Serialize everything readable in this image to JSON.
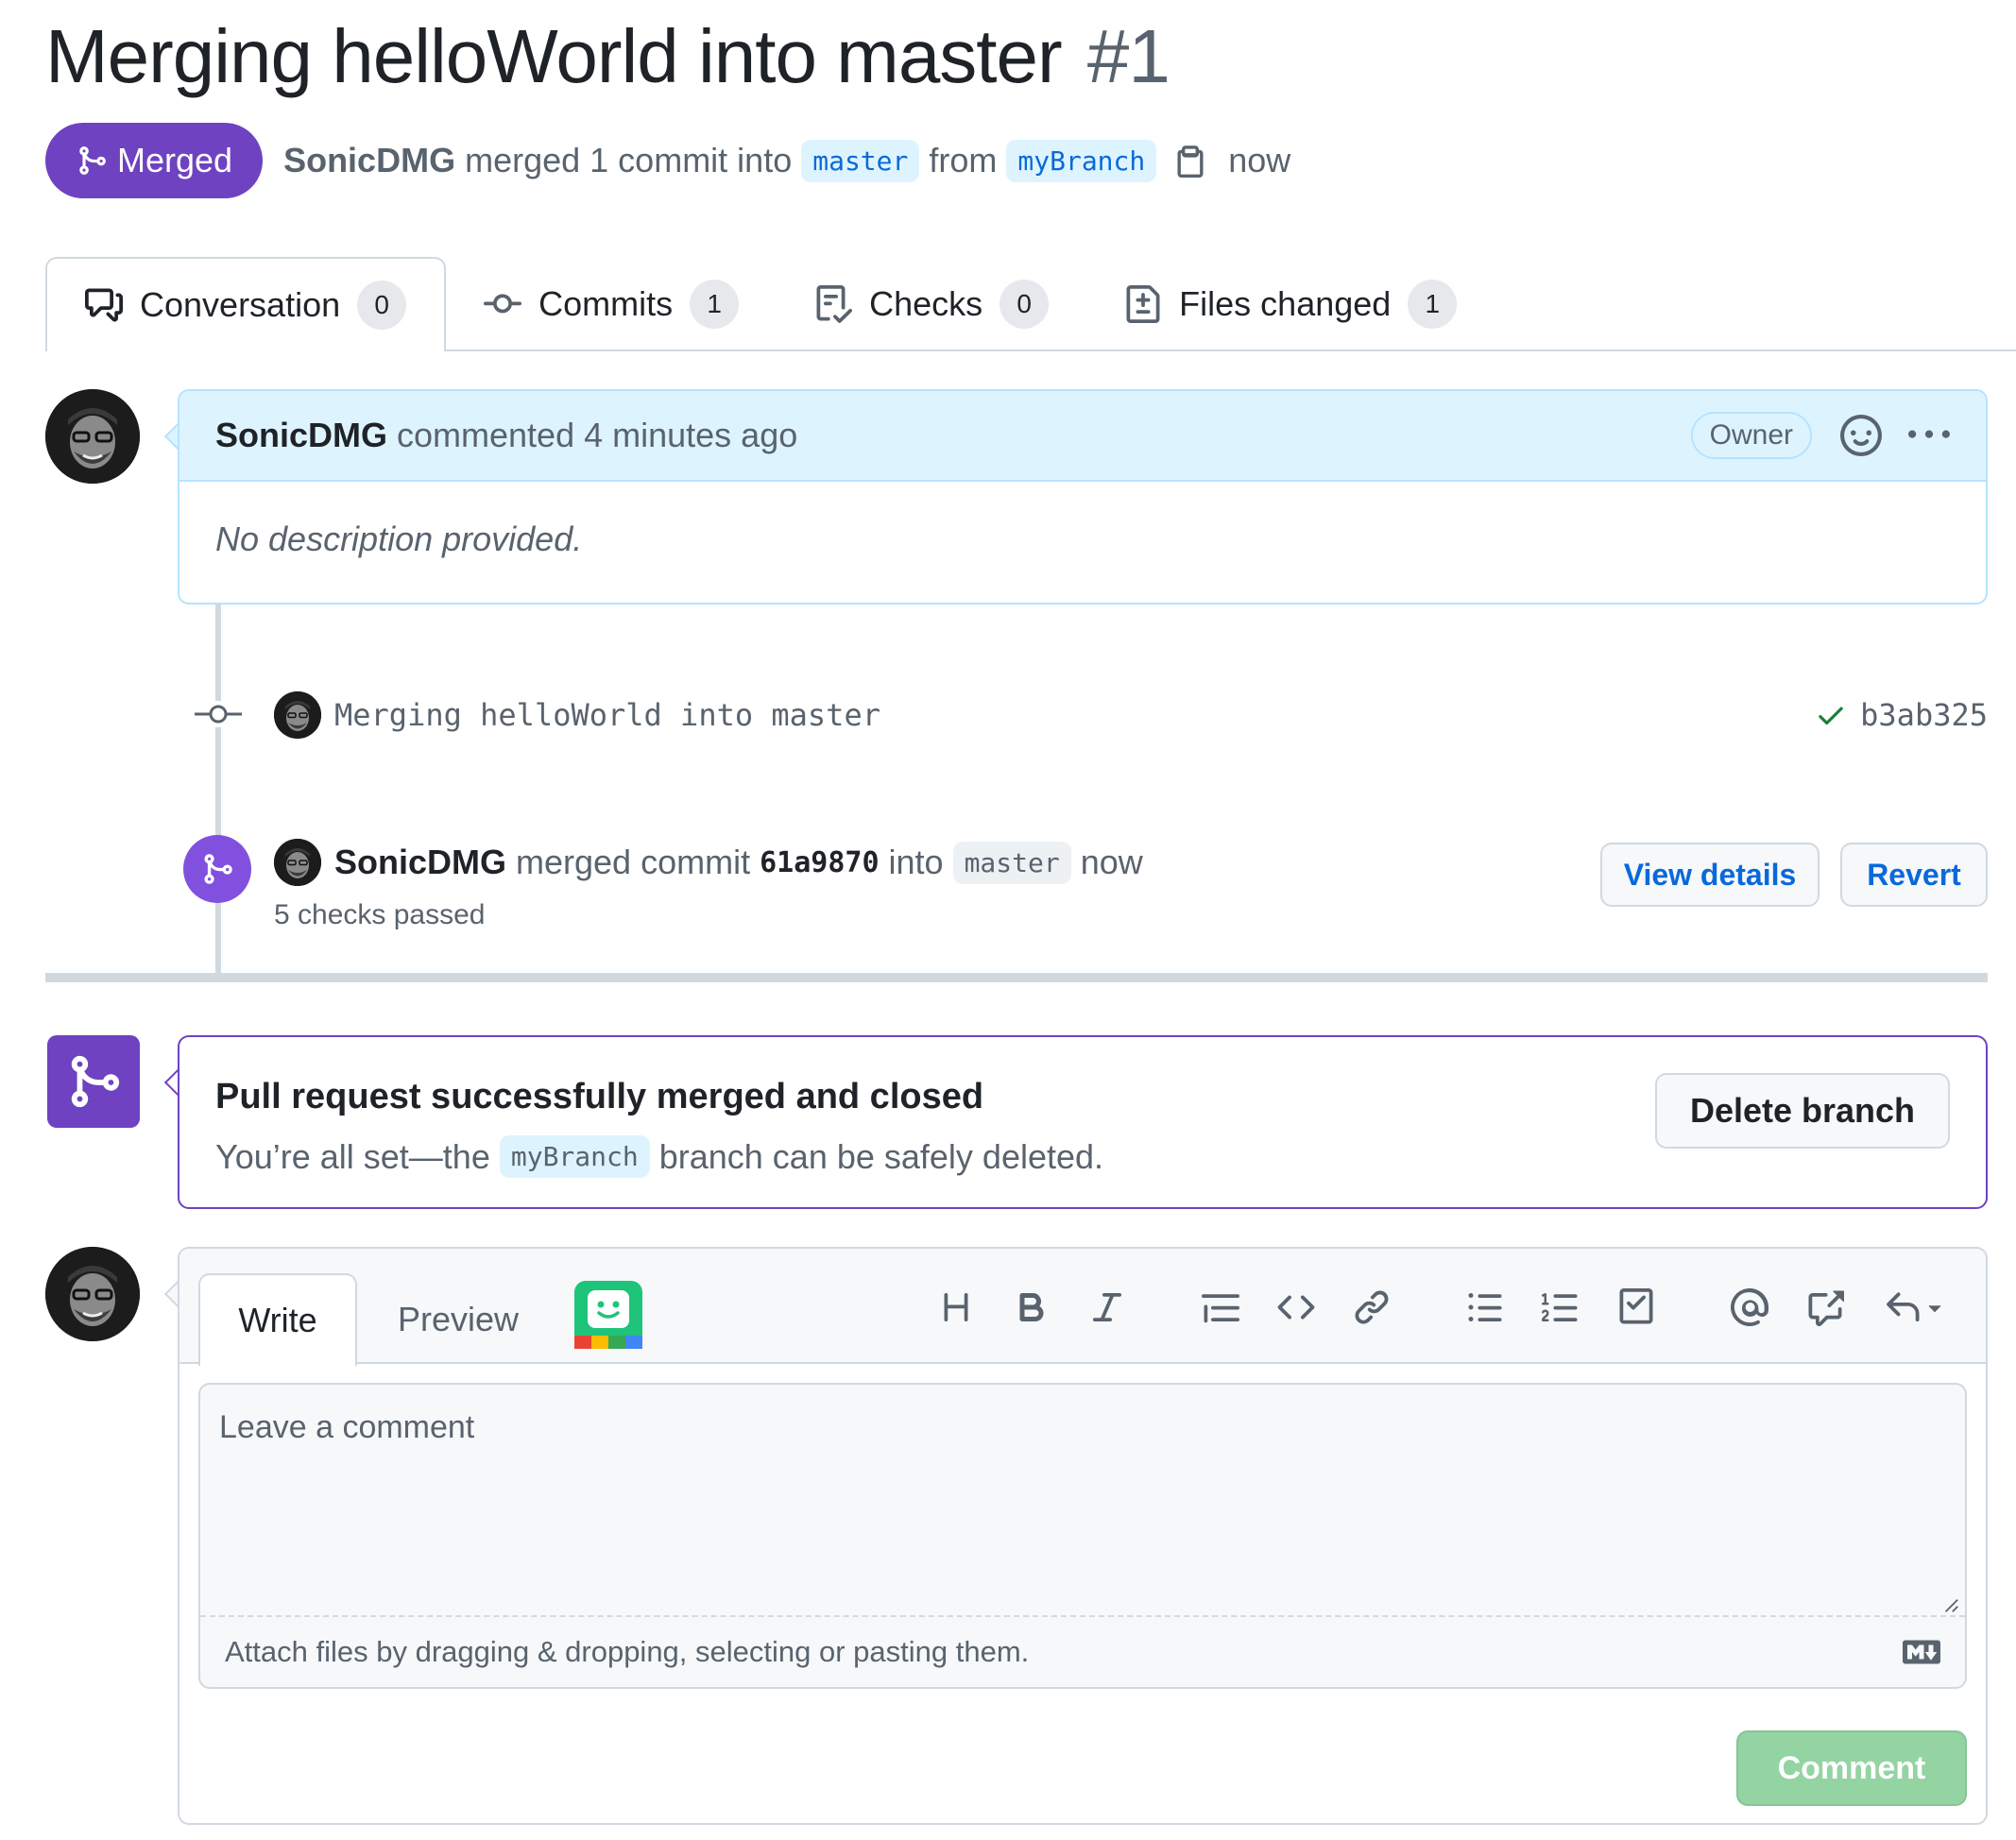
{
  "header": {
    "title": "Merging helloWorld into master",
    "number": "#1",
    "state": "Merged",
    "author": "SonicDMG",
    "merge_text": "merged 1 commit into",
    "base_branch": "master",
    "from_text": "from",
    "head_branch": "myBranch",
    "time": "now"
  },
  "tabs": [
    {
      "label": "Conversation",
      "count": "0",
      "icon": "comment-discussion-icon"
    },
    {
      "label": "Commits",
      "count": "1",
      "icon": "git-commit-icon"
    },
    {
      "label": "Checks",
      "count": "0",
      "icon": "checklist-icon"
    },
    {
      "label": "Files changed",
      "count": "1",
      "icon": "file-diff-icon"
    }
  ],
  "comment": {
    "author": "SonicDMG",
    "action": "commented 4 minutes ago",
    "role": "Owner",
    "body": "No description provided."
  },
  "commit": {
    "message": "Merging helloWorld into master",
    "sha": "b3ab325",
    "status": "success"
  },
  "merge_event": {
    "author": "SonicDMG",
    "text_before": "merged commit",
    "sha": "61a9870",
    "text_into": "into",
    "branch": "master",
    "time": "now",
    "checks": "5 checks passed",
    "view_details": "View details",
    "revert": "Revert"
  },
  "merged_box": {
    "title": "Pull request successfully merged and closed",
    "sub_before": "You’re all set—the",
    "branch": "myBranch",
    "sub_after": "branch can be safely deleted.",
    "delete_button": "Delete branch"
  },
  "composer": {
    "write_tab": "Write",
    "preview_tab": "Preview",
    "placeholder": "Leave a comment",
    "attach_text": "Attach files by dragging & dropping, selecting or pasting them.",
    "submit": "Comment",
    "toolbar": [
      "heading-icon",
      "bold-icon",
      "italic-icon",
      "quote-icon",
      "code-icon",
      "link-icon",
      "unordered-list-icon",
      "ordered-list-icon",
      "tasklist-icon",
      "mention-icon",
      "cross-reference-icon",
      "reply-icon"
    ]
  },
  "colors": {
    "merged_purple": "#6f42c1",
    "link_blue": "#0969da",
    "comment_header_bg": "#ddf4ff",
    "success_green": "#1a7f37",
    "comment_button_disabled": "#94d3a2"
  }
}
